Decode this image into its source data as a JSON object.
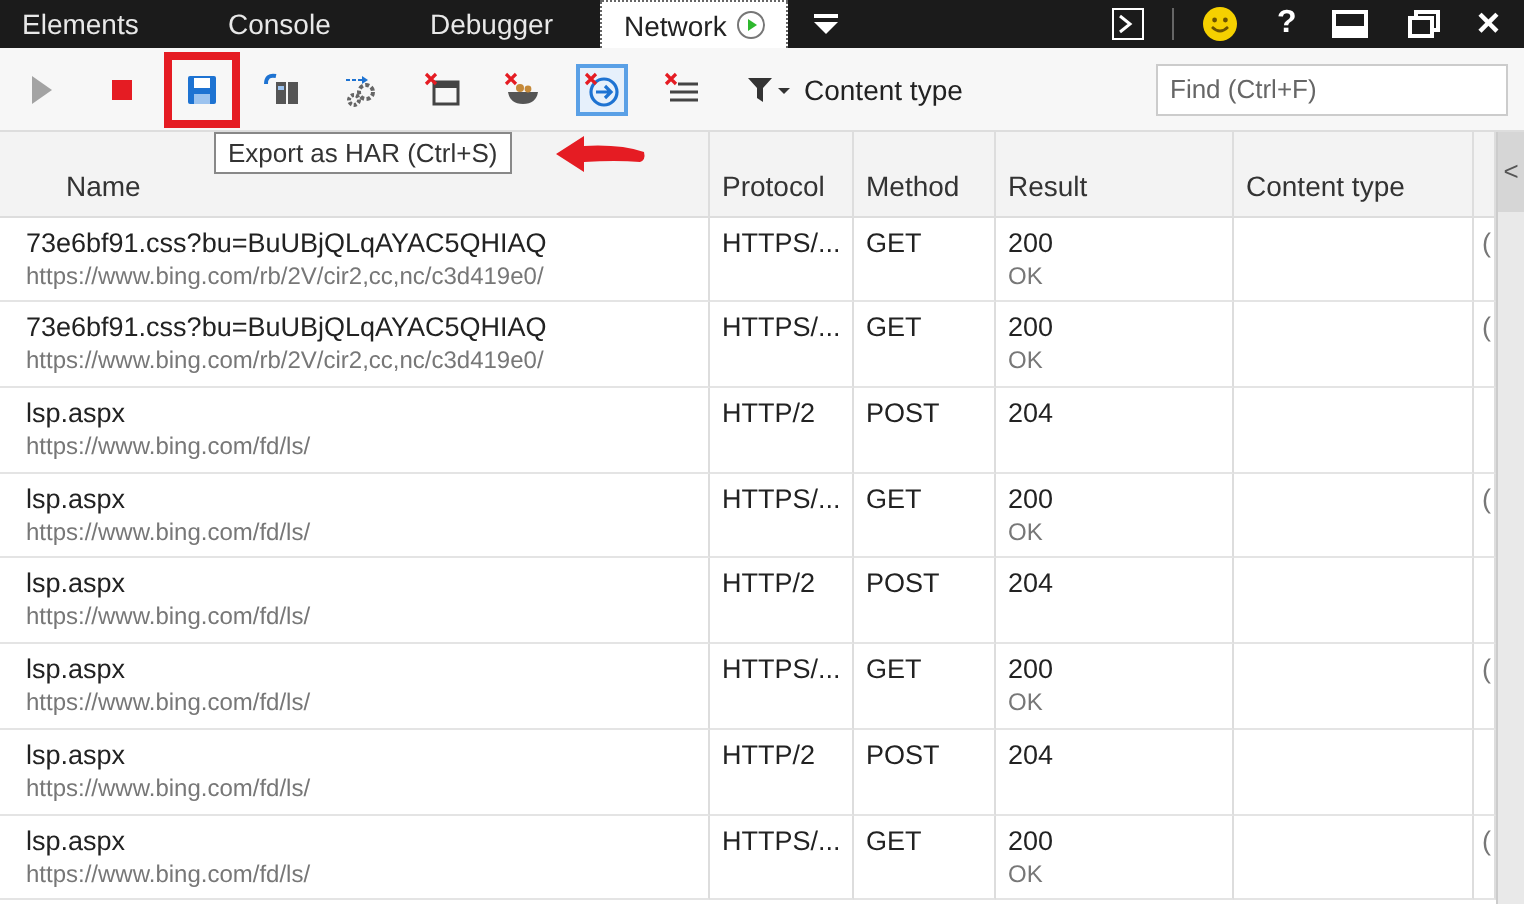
{
  "tabs": [
    {
      "label": "Elements",
      "selected": false
    },
    {
      "label": "Console",
      "selected": false
    },
    {
      "label": "Debugger",
      "selected": false
    },
    {
      "label": "Network",
      "selected": true,
      "recording": true
    }
  ],
  "window_controls": {
    "help": "?",
    "close": "×"
  },
  "toolbar": {
    "buttons": [
      {
        "kind": "start",
        "disabled": true,
        "selected": false,
        "callout": false
      },
      {
        "kind": "stop",
        "disabled": false,
        "selected": false,
        "callout": false
      },
      {
        "kind": "export",
        "disabled": false,
        "selected": false,
        "callout": true
      },
      {
        "kind": "import",
        "disabled": false,
        "selected": false,
        "callout": false
      },
      {
        "kind": "settings",
        "disabled": false,
        "selected": false,
        "callout": false
      },
      {
        "kind": "clear_window",
        "disabled": false,
        "selected": false,
        "callout": false
      },
      {
        "kind": "clear_cookies",
        "disabled": false,
        "selected": false,
        "callout": false
      },
      {
        "kind": "clear_navigate",
        "disabled": false,
        "selected": true,
        "callout": false
      },
      {
        "kind": "clear_list",
        "disabled": false,
        "selected": false,
        "callout": false
      }
    ],
    "filter_label": "Content type",
    "find_placeholder": "Find (Ctrl+F)",
    "tooltip": "Export as HAR (Ctrl+S)"
  },
  "table": {
    "columns": [
      "Name",
      "Protocol",
      "Method",
      "Result",
      "Content type"
    ],
    "side_toggle": "<",
    "rows": [
      {
        "name": "73e6bf91.css?bu=BuUBjQLqAYAC5QHIAQ",
        "url": "https://www.bing.com/rb/2V/cir2,cc,nc/c3d419e0/",
        "protocol": "HTTPS/...",
        "method": "GET",
        "result": "200",
        "status": "OK",
        "column_6": "("
      },
      {
        "name": "73e6bf91.css?bu=BuUBjQLqAYAC5QHIAQ",
        "url": "https://www.bing.com/rb/2V/cir2,cc,nc/c3d419e0/",
        "protocol": "HTTPS/...",
        "method": "GET",
        "result": "200",
        "status": "OK",
        "column_6": "("
      },
      {
        "name": "lsp.aspx",
        "url": "https://www.bing.com/fd/ls/",
        "protocol": "HTTP/2",
        "method": "POST",
        "result": "204"
      },
      {
        "name": "lsp.aspx",
        "url": "https://www.bing.com/fd/ls/",
        "protocol": "HTTPS/...",
        "method": "GET",
        "result": "200",
        "status": "OK",
        "column_6": "("
      },
      {
        "name": "lsp.aspx",
        "url": "https://www.bing.com/fd/ls/",
        "protocol": "HTTP/2",
        "method": "POST",
        "result": "204"
      },
      {
        "name": "lsp.aspx",
        "url": "https://www.bing.com/fd/ls/",
        "protocol": "HTTPS/...",
        "method": "GET",
        "result": "200",
        "status": "OK",
        "column_6": "("
      },
      {
        "name": "lsp.aspx",
        "url": "https://www.bing.com/fd/ls/",
        "protocol": "HTTP/2",
        "method": "POST",
        "result": "204"
      },
      {
        "name": "lsp.aspx",
        "url": "https://www.bing.com/fd/ls/",
        "protocol": "HTTPS/...",
        "method": "GET",
        "result": "200",
        "status": "OK",
        "column_6": "("
      }
    ]
  }
}
